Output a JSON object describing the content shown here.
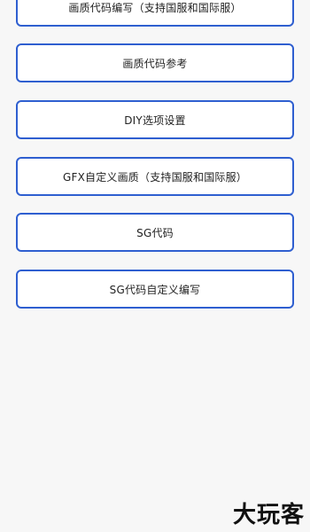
{
  "menu": {
    "items": [
      {
        "label": "画质代码编写（支持国服和国际服）"
      },
      {
        "label": "画质代码参考"
      },
      {
        "label": "DIY选项设置"
      },
      {
        "label": "GFX自定义画质（支持国服和国际服）"
      },
      {
        "label": "SG代码"
      },
      {
        "label": "SG代码自定义编写"
      }
    ]
  },
  "watermark": {
    "text": "大玩客"
  },
  "colors": {
    "button_border": "#2f5fd0",
    "background": "#f7f7f7"
  }
}
